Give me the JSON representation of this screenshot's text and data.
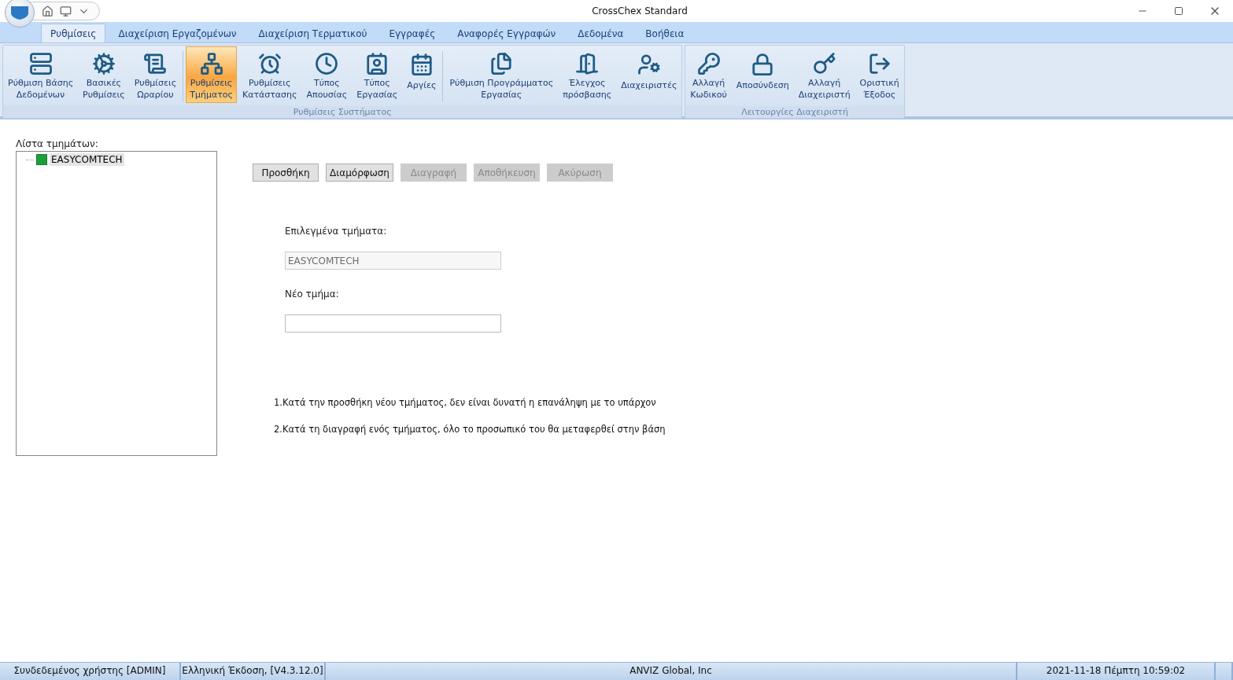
{
  "window": {
    "title": "CrossChex Standard"
  },
  "menu_tabs": [
    {
      "label": "Ρυθμίσεις",
      "selected": true
    },
    {
      "label": "Διαχείριση Εργαζομένων",
      "selected": false
    },
    {
      "label": "Διαχείριση Τερματικού",
      "selected": false
    },
    {
      "label": "Εγγραφές",
      "selected": false
    },
    {
      "label": "Αναφορές Εγγραφών",
      "selected": false
    },
    {
      "label": "Δεδομένα",
      "selected": false
    },
    {
      "label": "Βοήθεια",
      "selected": false
    }
  ],
  "ribbon": {
    "groups": [
      {
        "title": "Ρυθμίσεις Συστήματος",
        "buttons": [
          {
            "lines": [
              "Ρύθμιση Βάσης",
              "Δεδομένων"
            ],
            "selected": false,
            "divider_before": false
          },
          {
            "lines": [
              "Βασικές",
              "Ρυθμίσεις"
            ],
            "selected": false,
            "divider_before": false
          },
          {
            "lines": [
              "Ρυθμίσεις",
              "Ωραρίου"
            ],
            "selected": false,
            "divider_before": false
          },
          {
            "lines": [
              "Ρυθμίσεις",
              "Τμήματος"
            ],
            "selected": true,
            "divider_before": true
          },
          {
            "lines": [
              "Ρυθμίσεις",
              "Κατάστασης"
            ],
            "selected": false,
            "divider_before": false
          },
          {
            "lines": [
              "Τύπος",
              "Απουσίας"
            ],
            "selected": false,
            "divider_before": false
          },
          {
            "lines": [
              "Τύπος",
              "Εργασίας"
            ],
            "selected": false,
            "divider_before": false
          },
          {
            "lines": [
              "Αργίες"
            ],
            "selected": false,
            "divider_before": false
          },
          {
            "lines": [
              "Ρύθμιση Προγράμματος",
              "Εργασίας"
            ],
            "selected": false,
            "divider_before": true
          },
          {
            "lines": [
              "Έλεγχος",
              "πρόσβασης"
            ],
            "selected": false,
            "divider_before": false
          },
          {
            "lines": [
              "Διαχειριστές"
            ],
            "selected": false,
            "divider_before": false
          }
        ]
      },
      {
        "title": "Λειτουργίες Διαχειριστή",
        "buttons": [
          {
            "lines": [
              "Αλλαγή",
              "Κωδικού"
            ],
            "selected": false,
            "divider_before": false
          },
          {
            "lines": [
              "Αποσύνδεση"
            ],
            "selected": false,
            "divider_before": false
          },
          {
            "lines": [
              "Αλλαγή",
              "Διαχειριστή"
            ],
            "selected": false,
            "divider_before": false
          },
          {
            "lines": [
              "Οριστική",
              "Έξοδος"
            ],
            "selected": false,
            "divider_before": false
          }
        ]
      }
    ]
  },
  "department_list": {
    "label": "Λίστα τμημάτων:",
    "items": [
      {
        "label": "EASYCOMTECH",
        "selected": true
      }
    ]
  },
  "actions": [
    {
      "label": "Προσθήκη",
      "disabled": false
    },
    {
      "label": "Διαμόρφωση",
      "disabled": false
    },
    {
      "label": "Διαγραφή",
      "disabled": true
    },
    {
      "label": "Αποθήκευση",
      "disabled": true
    },
    {
      "label": "Ακύρωση",
      "disabled": true
    }
  ],
  "fields": [
    {
      "label": "Επιλεγμένα τμήματα:",
      "value": "EASYCOMTECH",
      "disabled": true
    },
    {
      "label": "Νέο τμήμα:",
      "disabled": false
    }
  ],
  "notes": [
    "1.Κατά την προσθήκη νέου τμήματος, δεν είναι δυνατή η επανάληψη με το υπάρχον",
    "2.Κατά τη διαγραφή ενός τμήματος, όλο το προσωπικό του θα μεταφερθεί στην βάση"
  ],
  "status_bar": [
    "Συνδεδεμένος χρήστης [ADMIN]",
    "Ελληνική Έκδοση, [V4.3.12.0]",
    "ANVIZ Global, Inc",
    "2021-11-18 Πέμπτη 10:59:02"
  ]
}
